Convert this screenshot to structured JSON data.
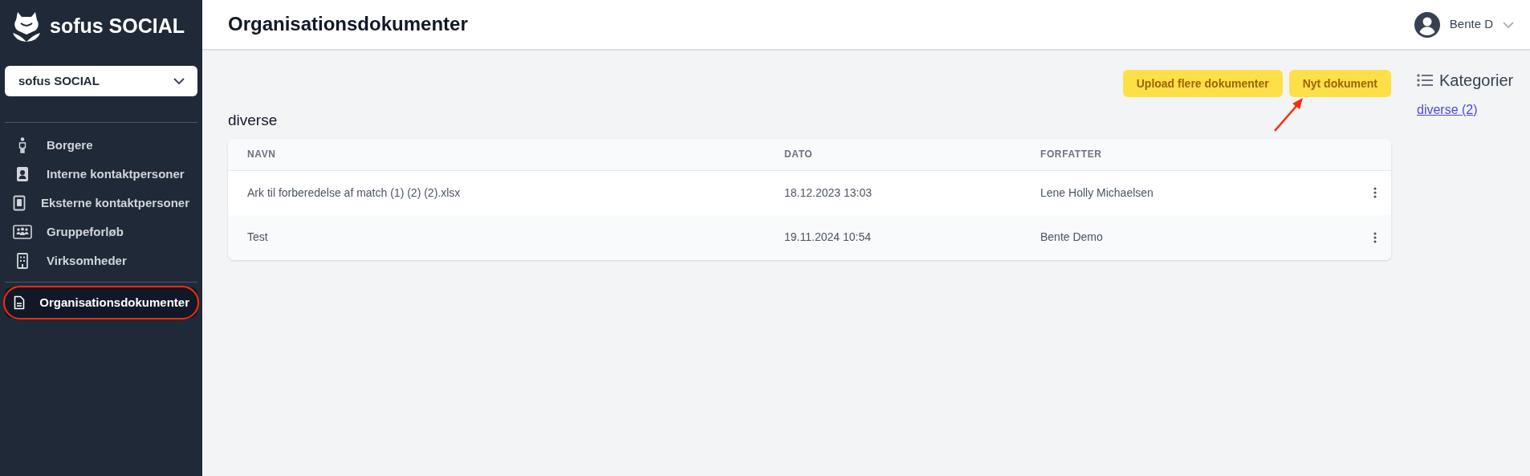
{
  "sidebar": {
    "brand": "sofus SOCIAL",
    "org_select": {
      "value": "sofus SOCIAL"
    },
    "items": [
      {
        "label": "Borgere",
        "selected": false,
        "circled": false
      },
      {
        "label": "Interne kontaktpersoner",
        "selected": false,
        "circled": false
      },
      {
        "label": "Eksterne kontaktpersoner",
        "selected": false,
        "circled": false
      },
      {
        "label": "Gruppeforløb",
        "selected": false,
        "circled": false
      },
      {
        "label": "Virksomheder",
        "selected": false,
        "circled": false
      },
      {
        "label": "Organisationsdokumenter",
        "selected": true,
        "circled": true
      }
    ]
  },
  "header": {
    "title": "Organisationsdokumenter",
    "user": "Bente D"
  },
  "actions": [
    {
      "label": "Upload flere dokumenter",
      "pointed": false
    },
    {
      "label": "Nyt dokument",
      "pointed": true
    }
  ],
  "category_title": "diverse",
  "table": {
    "columns": [
      "NAVN",
      "DATO",
      "FORFATTER"
    ],
    "rows": [
      {
        "name": "Ark til forberedelse af match (1) (2) (2).xlsx",
        "date": "18.12.2023 13:03",
        "author": "Lene Holly Michaelsen"
      },
      {
        "name": "Test",
        "date": "19.11.2024 10:54",
        "author": "Bente Demo"
      }
    ]
  },
  "categories": {
    "title": "Kategorier",
    "links": [
      "diverse (2)"
    ]
  }
}
